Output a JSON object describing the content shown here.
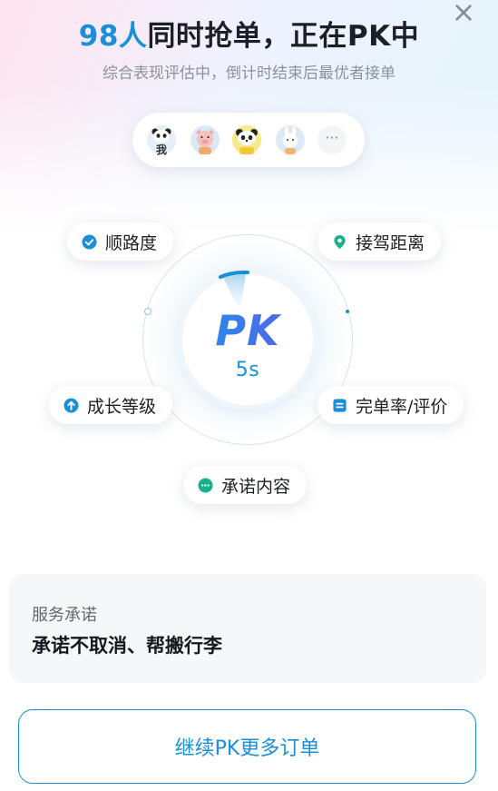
{
  "header": {
    "count": "98人",
    "title_rest": "同时抢单，正在PK中",
    "subtitle": "综合表现评估中，倒计时结束后最优者接单",
    "close_icon": "×"
  },
  "avatars": {
    "items": [
      {
        "icon": "panda-avatar-icon",
        "tag": "我"
      },
      {
        "icon": "pig-avatar-icon"
      },
      {
        "icon": "panda-avatar-icon"
      },
      {
        "icon": "rabbit-avatar-icon"
      }
    ],
    "more": "···"
  },
  "pk": {
    "logo": "PK",
    "timer": "5s"
  },
  "criteria": [
    {
      "label": "顺路度",
      "icon": "check-circle-icon",
      "color": "#1a8fd8"
    },
    {
      "label": "接驾距离",
      "icon": "location-pin-icon",
      "color": "#16b38a"
    },
    {
      "label": "成长等级",
      "icon": "arrow-up-circle-icon",
      "color": "#1a8fd8"
    },
    {
      "label": "完单率/评价",
      "icon": "document-icon",
      "color": "#1a8fd8"
    },
    {
      "label": "承诺内容",
      "icon": "chat-bubble-icon",
      "color": "#16b38a"
    }
  ],
  "service": {
    "label": "服务承诺",
    "content": "承诺不取消、帮搬行李"
  },
  "actions": {
    "more_orders": "继续PK更多订单"
  },
  "colors": {
    "accent": "#1a8fd8",
    "green": "#16b38a",
    "text": "#1c1f26"
  }
}
